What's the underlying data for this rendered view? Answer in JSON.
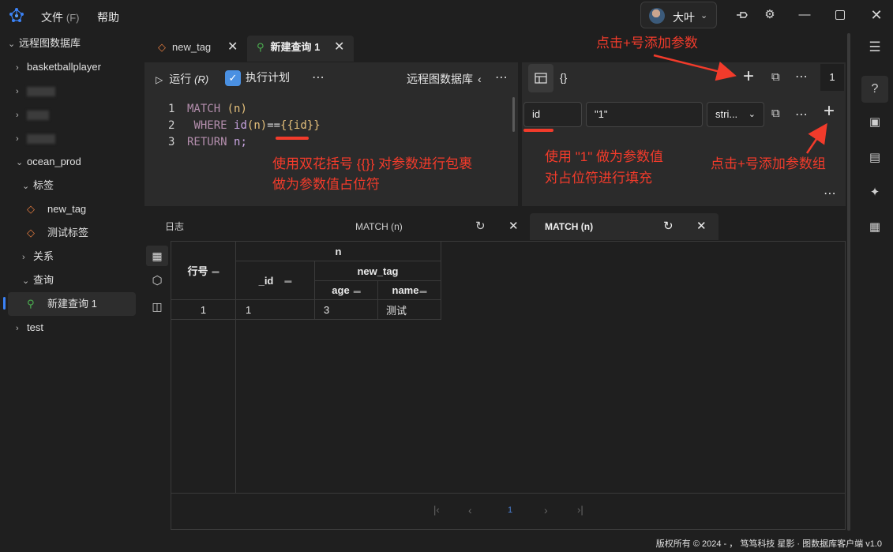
{
  "titlebar": {
    "menu_file": "文件",
    "menu_file_accel": "(F)",
    "menu_help": "帮助",
    "user_name": "大叶"
  },
  "sidebar": {
    "root": "远程图数据库",
    "items": [
      {
        "label": "basketballplayer"
      },
      {
        "label": "ocean_prod"
      },
      {
        "label": "标签"
      },
      {
        "label": "new_tag"
      },
      {
        "label": "测试标签"
      },
      {
        "label": "关系"
      },
      {
        "label": "查询"
      },
      {
        "label": "新建查询 1"
      },
      {
        "label": "test"
      }
    ]
  },
  "editor_tabs": [
    {
      "label": "new_tag"
    },
    {
      "label": "新建查询 1"
    }
  ],
  "editor": {
    "run_label": "运行",
    "run_accel": "(R)",
    "plan_label": "执行计划",
    "connection": "远程图数据库",
    "lines": [
      {
        "num": "1",
        "kw": "MATCH",
        "rest": "(n)"
      },
      {
        "num": "2",
        "kw": "WHERE",
        "fn": "id",
        "arg": "(n)",
        "op": "==",
        "ph": "{{id}}"
      },
      {
        "num": "3",
        "kw": "RETURN",
        "rest": "n;"
      }
    ]
  },
  "params": {
    "braces_label": "{}",
    "count": "1",
    "name": "id",
    "value": "\"1\"",
    "type": "stri..."
  },
  "result_tabs": [
    {
      "label": "日志"
    },
    {
      "label": "MATCH (n)"
    },
    {
      "label": "MATCH (n)"
    }
  ],
  "table": {
    "row_header": "行号",
    "group_n": "n",
    "col_id": "_id",
    "group_tag": "new_tag",
    "col_age": "age",
    "col_name": "name",
    "rows": [
      {
        "row": "1",
        "id": "1",
        "age": "3",
        "name": "测试"
      }
    ]
  },
  "pagination": {
    "page": "1"
  },
  "status": {
    "text": "版权所有 © 2024 - ，  笃笃科技  星影 · 图数据库客户端  v1.0"
  },
  "annotations": {
    "add_param": "点击+号添加参数",
    "wrap_hint_1": "使用双花括号 {{}} 对参数进行包裹",
    "wrap_hint_2": "做为参数值占位符",
    "fill_hint_1": "使用 \"1\" 做为参数值",
    "fill_hint_2": "对占位符进行填充",
    "add_group": "点击+号添加参数组"
  },
  "colors": {
    "annotation": "#f23b2b",
    "keyword": "#b48ead",
    "placeholder": "#e5c07b",
    "accent": "#3b82f6"
  }
}
